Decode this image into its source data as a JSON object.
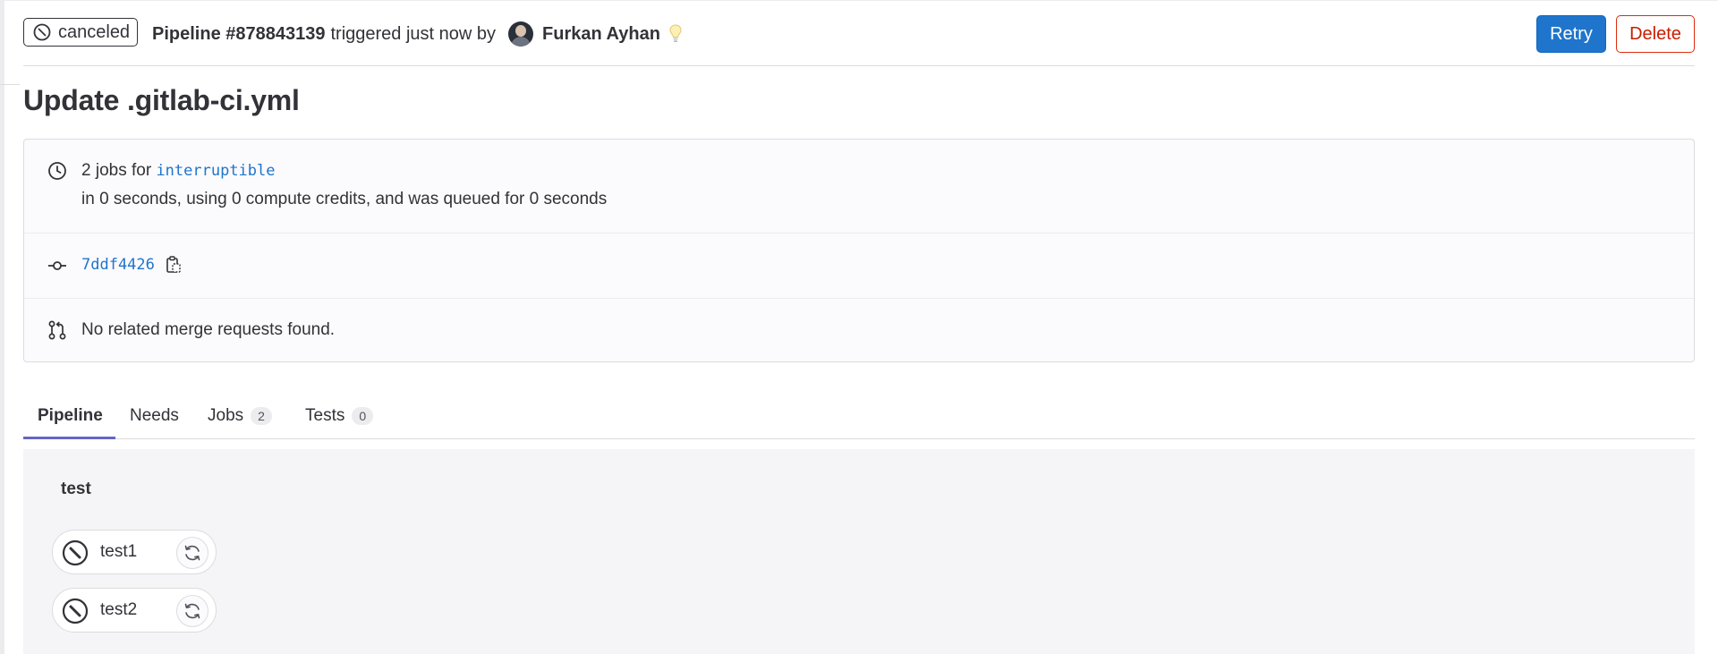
{
  "header": {
    "status_label": "canceled",
    "pipeline_id": "Pipeline #878843139",
    "trigger_text": "triggered just now by",
    "author_name": "Furkan Ayhan",
    "retry_label": "Retry",
    "delete_label": "Delete"
  },
  "commit_title": "Update .gitlab-ci.yml",
  "info": {
    "jobs_count_text": "2 jobs for",
    "ref_name": "interruptible",
    "duration_text": "in 0 seconds, using 0 compute credits, and was queued for 0 seconds",
    "commit_sha": "7ddf4426",
    "merge_requests_text": "No related merge requests found."
  },
  "tabs": [
    {
      "label": "Pipeline",
      "count": null
    },
    {
      "label": "Needs",
      "count": null
    },
    {
      "label": "Jobs",
      "count": "2"
    },
    {
      "label": "Tests",
      "count": "0"
    }
  ],
  "graph": {
    "stage_name": "test",
    "jobs": [
      {
        "name": "test1",
        "status": "canceled"
      },
      {
        "name": "test2",
        "status": "canceled"
      }
    ]
  },
  "colors": {
    "primary_button": "#1f75cb",
    "danger": "#dd2b0e",
    "link": "#1f75cb",
    "active_tab_underline": "#6666c4",
    "canceled": "#333238"
  },
  "icons": {
    "status": "canceled-icon",
    "clock": "clock-icon",
    "commit": "commit-icon",
    "copy": "copy-to-clipboard-icon",
    "merge_request": "merge-request-icon",
    "retry": "retry-icon",
    "bulb": "lightbulb-icon"
  }
}
